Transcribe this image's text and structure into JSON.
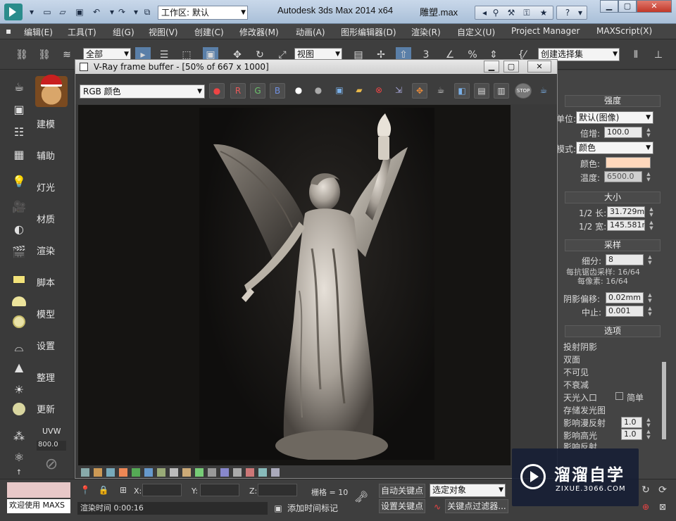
{
  "titlebar": {
    "workspace_label": "工作区: 默认",
    "app_title": "Autodesk 3ds Max  2014 x64",
    "file_title": "雕塑.max"
  },
  "menu": {
    "items": [
      "编辑(E)",
      "工具(T)",
      "组(G)",
      "视图(V)",
      "创建(C)",
      "修改器(M)",
      "动画(A)",
      "图形编辑器(D)",
      "渲染(R)",
      "自定义(U)",
      "Project Manager",
      "MAXScript(X)"
    ]
  },
  "toolbar": {
    "selection_filter": "全部",
    "ref_coord": "视图",
    "snap_number": "3",
    "named_selection": "创建选择集"
  },
  "leftbar": {
    "labels": [
      "建模",
      "辅助",
      "灯光",
      "材质",
      "渲染",
      "脚本",
      "模型",
      "设置",
      "整理",
      "更新",
      "UVW"
    ],
    "small_value": "800.0"
  },
  "vfb": {
    "title": "V-Ray frame buffer - [50% of 667 x 1000]",
    "channel": "RGB 颜色",
    "r_label": "R",
    "g_label": "G",
    "b_label": "B",
    "stop_label": "STOP"
  },
  "rightpanel": {
    "intensity_title": "强度",
    "unit_label": "单位:",
    "unit_value": "默认(图像)",
    "mult_label": "倍增:",
    "mult_value": "100.0",
    "mode_label": "模式:",
    "mode_value": "颜色",
    "color_label": "颜色:",
    "color_swatch": "#ffd8bc",
    "temp_label": "温度:",
    "temp_value": "6500.0",
    "size_title": "大小",
    "half_len_label": "1/2 长:",
    "half_len_value": "31.729mm",
    "half_wid_label": "1/2 宽:",
    "half_wid_value": "145.581mm",
    "sampling_title": "采样",
    "subdivs_label": "细分:",
    "subdivs_value": "8",
    "aa_samples": "每抗锯齿采样: 16/64",
    "per_pixel": "每像素: 16/64",
    "shadow_bias_label": "阴影偏移:",
    "shadow_bias_value": "0.02mm",
    "cutoff_label": "中止:",
    "cutoff_value": "0.001",
    "options_title": "选项",
    "options": [
      "投射阴影",
      "双面",
      "不可见",
      "不衰减",
      "天光入口",
      "存储发光图",
      "影响漫反射",
      "影响高光",
      "影响反射"
    ],
    "simple_label": "简单",
    "diffuse_value": "1.0",
    "specular_value": "1.0"
  },
  "bottom": {
    "welcome": "欢迎使用 MAXS",
    "x_label": "X:",
    "y_label": "Y:",
    "z_label": "Z:",
    "grid_label": "栅格 = 10",
    "auto_key": "自动关键点",
    "sel_object": "选定对象",
    "set_key": "设置关键点",
    "key_filter": "关键点过滤器...",
    "render_time": "渲染时间  0:00:16",
    "add_time_tag": "添加时间标记"
  },
  "watermark": {
    "brand": "溜溜自学",
    "url": "ZIXUE.3066.COM"
  }
}
